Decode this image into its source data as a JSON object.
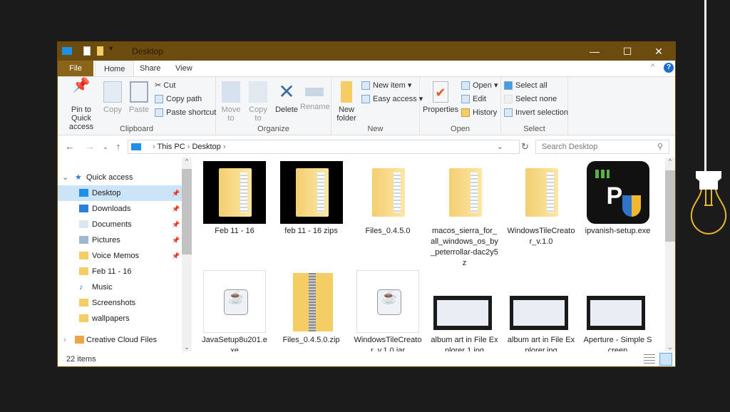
{
  "window": {
    "title": "Desktop",
    "controls": {
      "minimize": "—",
      "maximize": "☐",
      "close": "✕"
    }
  },
  "ribbon_tabs": [
    "File",
    "Home",
    "Share",
    "View"
  ],
  "ribbon": {
    "clipboard": {
      "label": "Clipboard",
      "pin": "Pin to Quick access",
      "copy": "Copy",
      "paste": "Paste",
      "cut": "Cut",
      "copy_path": "Copy path",
      "paste_shortcut": "Paste shortcut"
    },
    "organize": {
      "label": "Organize",
      "move_to": "Move to",
      "copy_to": "Copy to",
      "delete": "Delete",
      "rename": "Rename"
    },
    "new": {
      "label": "New",
      "new_folder": "New folder",
      "new_item": "New item",
      "easy_access": "Easy access"
    },
    "open": {
      "label": "Open",
      "properties": "Properties",
      "open": "Open",
      "edit": "Edit",
      "history": "History"
    },
    "select": {
      "label": "Select",
      "select_all": "Select all",
      "select_none": "Select none",
      "invert": "Invert selection"
    }
  },
  "address": {
    "path": [
      "This PC",
      "Desktop"
    ],
    "search_placeholder": "Search Desktop"
  },
  "nav": {
    "quick_access": "Quick access",
    "items": [
      {
        "label": "Desktop",
        "pinned": true,
        "selected": true,
        "icon": "desktop-icon"
      },
      {
        "label": "Downloads",
        "pinned": true,
        "icon": "download-icon"
      },
      {
        "label": "Documents",
        "pinned": true,
        "icon": "documents-icon"
      },
      {
        "label": "Pictures",
        "pinned": true,
        "icon": "pictures-icon"
      },
      {
        "label": "Voice Memos",
        "pinned": true,
        "icon": "folder-icon"
      },
      {
        "label": "Feb 11 - 16",
        "icon": "folder-icon"
      },
      {
        "label": "Music",
        "icon": "music-icon"
      },
      {
        "label": "Screenshots",
        "icon": "folder-icon"
      },
      {
        "label": "wallpapers",
        "icon": "folder-icon"
      }
    ],
    "creative_cloud": "Creative Cloud Files"
  },
  "files": [
    {
      "name": "Feb 11 - 16",
      "type": "folder-dark"
    },
    {
      "name": "feb 11 - 16 zips",
      "type": "folder-dark"
    },
    {
      "name": "Files_0.4.5.0",
      "type": "folder"
    },
    {
      "name": "macos_sierra_for_all_windows_os_by_peterrollar-dac2y5z",
      "type": "folder"
    },
    {
      "name": "WindowsTileCreator_v.1.0",
      "type": "folder"
    },
    {
      "name": "ipvanish-setup.exe",
      "type": "ipvanish"
    },
    {
      "name": "JavaSetup8u201.exe",
      "type": "java"
    },
    {
      "name": "Files_0.4.5.0.zip",
      "type": "zip"
    },
    {
      "name": "WindowsTileCreator_v.1.0.jar",
      "type": "java"
    },
    {
      "name": "album art in File Explorer 1.jpg",
      "type": "image"
    },
    {
      "name": "album art in File Explorer.jpg",
      "type": "image"
    },
    {
      "name": "Aperture - Simple Screen",
      "type": "image"
    }
  ],
  "status": {
    "count": "22 items"
  },
  "colors": {
    "titlebar": "#6b4c0e",
    "file_tab": "#8a6418",
    "selection": "#cce4f7"
  }
}
